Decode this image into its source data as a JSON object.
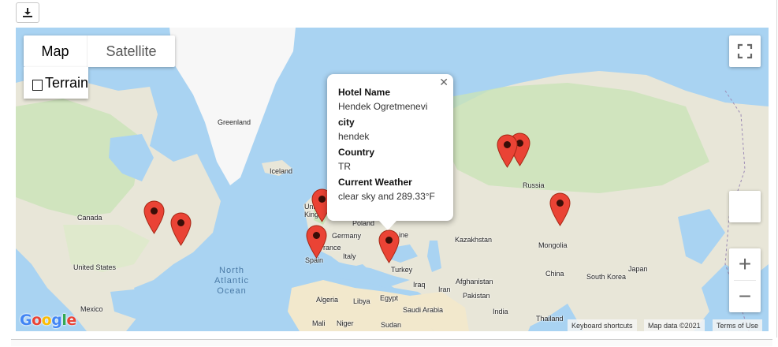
{
  "toolbar": {
    "download_icon": "download-icon"
  },
  "map_controls": {
    "map_label": "Map",
    "satellite_label": "Satellite",
    "terrain_label": "Terrain",
    "fullscreen_icon": "fullscreen-icon",
    "pegman_icon": "pegman-icon",
    "zoom_in": "+",
    "zoom_out": "−"
  },
  "map_labels": {
    "greenland": "Greenland",
    "iceland": "Iceland",
    "canada": "Canada",
    "united_states": "United States",
    "mexico": "Mexico",
    "ocean_line1": "North",
    "ocean_line2": "Atlantic",
    "ocean_line3": "Ocean",
    "united_kingdom_1": "Unit",
    "united_kingdom_2": "Kingdo",
    "germany": "Germany",
    "poland": "Poland",
    "ukraine": "ine",
    "france": "rance",
    "spain": "Spain",
    "italy": "Italy",
    "turkey": "Turkey",
    "algeria": "Algeria",
    "libya": "Libya",
    "egypt": "Egypt",
    "mali": "Mali",
    "niger": "Niger",
    "sudan": "Sudan",
    "iraq": "Iraq",
    "iran": "Iran",
    "saudi_arabia": "Saudi Arabia",
    "afghanistan": "Afghanistan",
    "pakistan": "Pakistan",
    "india": "India",
    "kazakhstan": "Kazakhstan",
    "russia": "Russia",
    "mongolia": "Mongolia",
    "china": "China",
    "south_korea": "South Korea",
    "japan": "Japan",
    "thailand": "Thailand"
  },
  "footer": {
    "google_logo": "Google",
    "keyboard_shortcuts": "Keyboard shortcuts",
    "map_data": "Map data ©2021",
    "terms": "Terms of Use"
  },
  "info_window": {
    "hotel_name_label": "Hotel Name",
    "hotel_name_value": "Hendek Ogretmenevi",
    "city_label": "city",
    "city_value": "hendek",
    "country_label": "Country",
    "country_value": "TR",
    "weather_label": "Current Weather",
    "weather_value": "clear sky and 289.33°F",
    "close_icon": "close-icon"
  },
  "colors": {
    "water": "#a9d3f2",
    "land": "#e8e6d8",
    "forest": "#c9e3b8",
    "ice": "#f7f7f7",
    "desert": "#f2e8cc",
    "marker": "#ea4335",
    "marker_dark": "#a52714"
  }
}
